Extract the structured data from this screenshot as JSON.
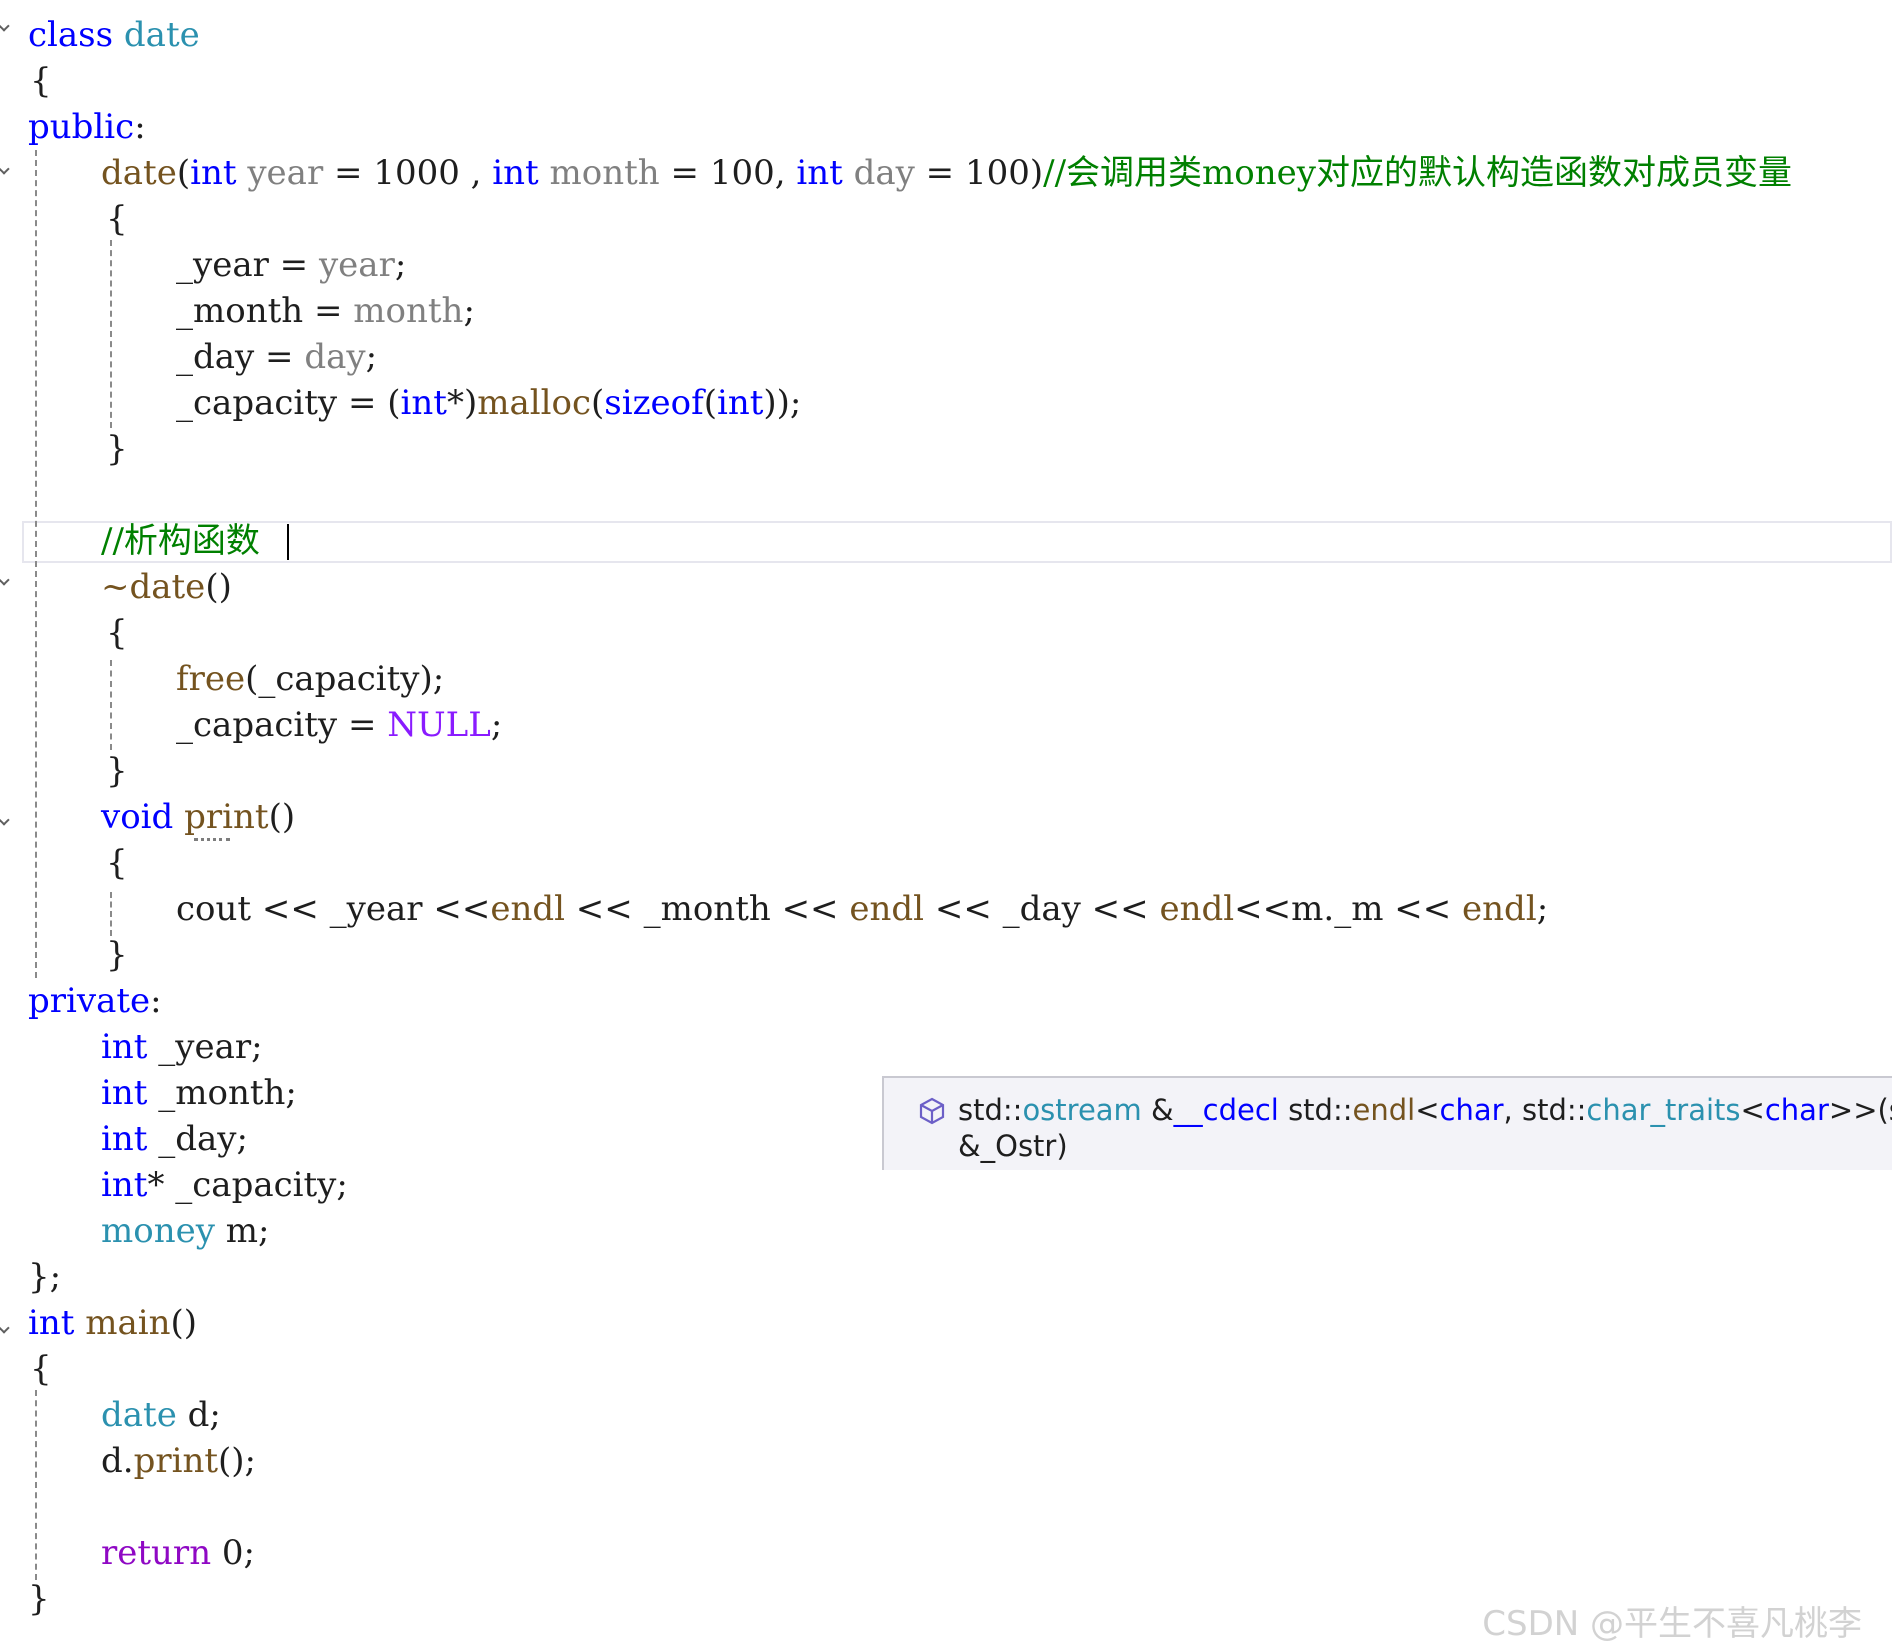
{
  "code_lines": [
    {
      "tokens": [
        [
          "kw",
          "class"
        ],
        [
          "plain",
          " "
        ],
        [
          "class",
          "date"
        ]
      ]
    },
    {
      "tokens": [
        [
          "punct",
          "{"
        ]
      ]
    },
    {
      "tokens": [
        [
          "kw",
          "public"
        ],
        [
          "punct",
          ":"
        ]
      ]
    },
    {
      "tokens": [
        [
          "func",
          "date"
        ],
        [
          "punct",
          "("
        ],
        [
          "kw",
          "int"
        ],
        [
          "plain",
          " "
        ],
        [
          "param",
          "year"
        ],
        [
          "op",
          " = "
        ],
        [
          "num",
          "1000"
        ],
        [
          "punct",
          " , "
        ],
        [
          "kw",
          "int"
        ],
        [
          "plain",
          " "
        ],
        [
          "param",
          "month"
        ],
        [
          "op",
          " = "
        ],
        [
          "num",
          "100"
        ],
        [
          "punct",
          ", "
        ],
        [
          "kw",
          "int"
        ],
        [
          "plain",
          " "
        ],
        [
          "param",
          "day"
        ],
        [
          "op",
          " = "
        ],
        [
          "num",
          "100"
        ],
        [
          "punct",
          ")"
        ],
        [
          "comment",
          "//会调用类money对应的默认构造函数对成员变量"
        ]
      ]
    },
    {
      "tokens": [
        [
          "punct",
          "{"
        ]
      ]
    },
    {
      "tokens": [
        [
          "member",
          "_year"
        ],
        [
          "op",
          " = "
        ],
        [
          "param",
          "year"
        ],
        [
          "punct",
          ";"
        ]
      ]
    },
    {
      "tokens": [
        [
          "member",
          "_month"
        ],
        [
          "op",
          " = "
        ],
        [
          "param",
          "month"
        ],
        [
          "punct",
          ";"
        ]
      ]
    },
    {
      "tokens": [
        [
          "member",
          "_day"
        ],
        [
          "op",
          " = "
        ],
        [
          "param",
          "day"
        ],
        [
          "punct",
          ";"
        ]
      ]
    },
    {
      "tokens": [
        [
          "member",
          "_capacity"
        ],
        [
          "op",
          " = "
        ],
        [
          "punct",
          "("
        ],
        [
          "kw",
          "int"
        ],
        [
          "op",
          "*"
        ],
        [
          "punct",
          ")"
        ],
        [
          "func",
          "malloc"
        ],
        [
          "punct",
          "("
        ],
        [
          "kw",
          "sizeof"
        ],
        [
          "punct",
          "("
        ],
        [
          "kw",
          "int"
        ],
        [
          "punct",
          "));"
        ]
      ]
    },
    {
      "tokens": [
        [
          "punct",
          "}"
        ]
      ]
    },
    {
      "tokens": []
    },
    {
      "tokens": [
        [
          "comment",
          "//析构函数"
        ]
      ]
    },
    {
      "tokens": [
        [
          "func",
          "~date"
        ],
        [
          "punct",
          "()"
        ]
      ]
    },
    {
      "tokens": [
        [
          "punct",
          "{"
        ]
      ]
    },
    {
      "tokens": [
        [
          "func",
          "free"
        ],
        [
          "punct",
          "("
        ],
        [
          "member",
          "_capacity"
        ],
        [
          "punct",
          ");"
        ]
      ]
    },
    {
      "tokens": [
        [
          "member",
          "_capacity"
        ],
        [
          "op",
          " = "
        ],
        [
          "macro",
          "NULL"
        ],
        [
          "punct",
          ";"
        ]
      ]
    },
    {
      "tokens": [
        [
          "punct",
          "}"
        ]
      ]
    },
    {
      "tokens": [
        [
          "kw",
          "void"
        ],
        [
          "plain",
          " "
        ],
        [
          "func",
          "print"
        ],
        [
          "punct",
          "()"
        ]
      ]
    },
    {
      "tokens": [
        [
          "punct",
          "{"
        ]
      ]
    },
    {
      "tokens": [
        [
          "var",
          "cout"
        ],
        [
          "op",
          " << "
        ],
        [
          "member",
          "_year"
        ],
        [
          "op",
          " <<"
        ],
        [
          "func",
          "endl"
        ],
        [
          "op",
          " << "
        ],
        [
          "member",
          "_month"
        ],
        [
          "op",
          " << "
        ],
        [
          "func",
          "endl"
        ],
        [
          "op",
          " << "
        ],
        [
          "member",
          "_day"
        ],
        [
          "op",
          " << "
        ],
        [
          "func",
          "endl"
        ],
        [
          "op",
          "<<"
        ],
        [
          "member",
          "m"
        ],
        [
          "punct",
          "."
        ],
        [
          "member",
          "_m"
        ],
        [
          "op",
          " << "
        ],
        [
          "func",
          "endl"
        ],
        [
          "punct",
          ";"
        ]
      ]
    },
    {
      "tokens": [
        [
          "punct",
          "}"
        ]
      ]
    },
    {
      "tokens": [
        [
          "kw",
          "private"
        ],
        [
          "punct",
          ":"
        ]
      ]
    },
    {
      "tokens": [
        [
          "kw",
          "int"
        ],
        [
          "plain",
          " "
        ],
        [
          "member",
          "_year"
        ],
        [
          "punct",
          ";"
        ]
      ]
    },
    {
      "tokens": [
        [
          "kw",
          "int"
        ],
        [
          "plain",
          " "
        ],
        [
          "member",
          "_month"
        ],
        [
          "punct",
          ";"
        ]
      ]
    },
    {
      "tokens": [
        [
          "kw",
          "int"
        ],
        [
          "plain",
          " "
        ],
        [
          "member",
          "_day"
        ],
        [
          "punct",
          ";"
        ]
      ]
    },
    {
      "tokens": [
        [
          "kw",
          "int"
        ],
        [
          "op",
          "*"
        ],
        [
          "plain",
          " "
        ],
        [
          "member",
          "_capacity"
        ],
        [
          "punct",
          ";"
        ]
      ]
    },
    {
      "tokens": [
        [
          "class",
          "money"
        ],
        [
          "plain",
          " "
        ],
        [
          "member",
          "m"
        ],
        [
          "punct",
          ";"
        ]
      ]
    },
    {
      "tokens": [
        [
          "punct",
          "};"
        ]
      ]
    },
    {
      "tokens": [
        [
          "kw",
          "int"
        ],
        [
          "plain",
          " "
        ],
        [
          "func",
          "main"
        ],
        [
          "punct",
          "()"
        ]
      ]
    },
    {
      "tokens": [
        [
          "punct",
          "{"
        ]
      ]
    },
    {
      "tokens": [
        [
          "class",
          "date"
        ],
        [
          "plain",
          " "
        ],
        [
          "var",
          "d"
        ],
        [
          "punct",
          ";"
        ]
      ]
    },
    {
      "tokens": [
        [
          "var",
          "d"
        ],
        [
          "punct",
          "."
        ],
        [
          "func",
          "print"
        ],
        [
          "punct",
          "();"
        ]
      ]
    },
    {
      "tokens": []
    },
    {
      "tokens": [
        [
          "kw2",
          "return"
        ],
        [
          "plain",
          " "
        ],
        [
          "num",
          "0"
        ],
        [
          "punct",
          ";"
        ]
      ]
    },
    {
      "tokens": [
        [
          "punct",
          "}"
        ]
      ]
    }
  ],
  "tooltip": {
    "icon": "cube-icon",
    "row1": [
      [
        "plain",
        "std::"
      ],
      [
        "type",
        "ostream"
      ],
      [
        "plain",
        " &"
      ],
      [
        "kw",
        "__cdecl"
      ],
      [
        "plain",
        " std::"
      ],
      [
        "func",
        "endl"
      ],
      [
        "plain",
        "<"
      ],
      [
        "kw",
        "char"
      ],
      [
        "plain",
        ", std::"
      ],
      [
        "type",
        "char_traits"
      ],
      [
        "plain",
        "<"
      ],
      [
        "kw",
        "char"
      ],
      [
        "plain",
        ">>(std::"
      ],
      [
        "type",
        "ostream"
      ]
    ],
    "row2": [
      [
        "plain",
        "&_Ostr)"
      ]
    ]
  },
  "watermark": "CSDN @平生不喜凡桃李",
  "colors": {
    "keyword": "#0000ff",
    "control_keyword": "#8f08c4",
    "type": "#2b91af",
    "function": "#74531f",
    "parameter": "#808080",
    "comment": "#008000",
    "macro": "#8a1bff"
  }
}
